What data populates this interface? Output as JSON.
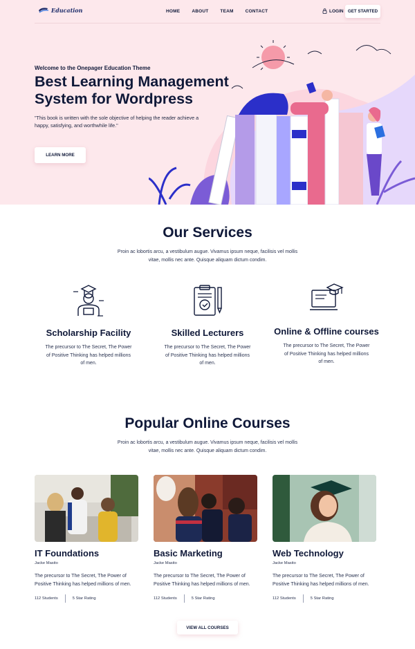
{
  "brand": {
    "name": "Education"
  },
  "nav": {
    "links": [
      "HOME",
      "ABOUT",
      "TEAM",
      "CONTACT"
    ],
    "login": "LOGIN",
    "cta": "GET STARTED"
  },
  "hero": {
    "welcome": "Welcome to the Onepager Education Theme",
    "title": "Best Learning Management System for Wordpress",
    "quote": "\"This book is written with the sole objective of helping the reader achieve a happy, satisfying, and worthwhile life.\"",
    "button": "LEARN MORE"
  },
  "services": {
    "title": "Our Services",
    "subtitle": "Proin ac lobortis arcu, a vestibulum augue. Vivamus ipsum neque, facilisis vel mollis vitae, mollis nec ante. Quisque aliquam dictum condim.",
    "items": [
      {
        "title": "Scholarship Facility",
        "desc": "The precursor to The Secret, The Power of Positive Thinking has helped millions of men.",
        "icon": "graduate-icon"
      },
      {
        "title": "Skilled Lecturers",
        "desc": "The precursor to The Secret, The Power of Positive Thinking has helped millions of men.",
        "icon": "clipboard-certificate-icon"
      },
      {
        "title": "Online & Offline courses",
        "desc": "The precursor to The Secret, The Power of Positive Thinking has helped millions of men.",
        "icon": "laptop-graduation-icon"
      }
    ]
  },
  "courses": {
    "title": "Popular Online Courses",
    "subtitle": "Proin ac lobortis arcu, a vestibulum augue. Vivamus ipsum neque, facilisis vel mollis vitae, mollis nec ante. Quisque aliquam dictum condim.",
    "items": [
      {
        "title": "IT Foundations",
        "author": "Jacke Masito",
        "desc": "The precursor to The Secret, The Power of Positive Thinking has helped millions of men.",
        "students": "112 Students",
        "rating": "5 Star Rating"
      },
      {
        "title": "Basic Marketing",
        "author": "Jacke Masito",
        "desc": "The precursor to The Secret, The Power of Positive Thinking has helped millions of men.",
        "students": "112 Students",
        "rating": "5 Star Rating"
      },
      {
        "title": "Web Technology",
        "author": "Jacke Masito",
        "desc": "The precursor to The Secret, The Power of Positive Thinking has helped millions of men.",
        "students": "112 Students",
        "rating": "5 Star Rating"
      }
    ],
    "view_all": "VIEW ALL COURSES"
  },
  "colors": {
    "accent_navy": "#0f1838",
    "hero_bg": "#fde8ec",
    "book_purple": "#7b5cd6",
    "book_pink": "#e96a8e",
    "figure_blue": "#2b2fc9"
  }
}
